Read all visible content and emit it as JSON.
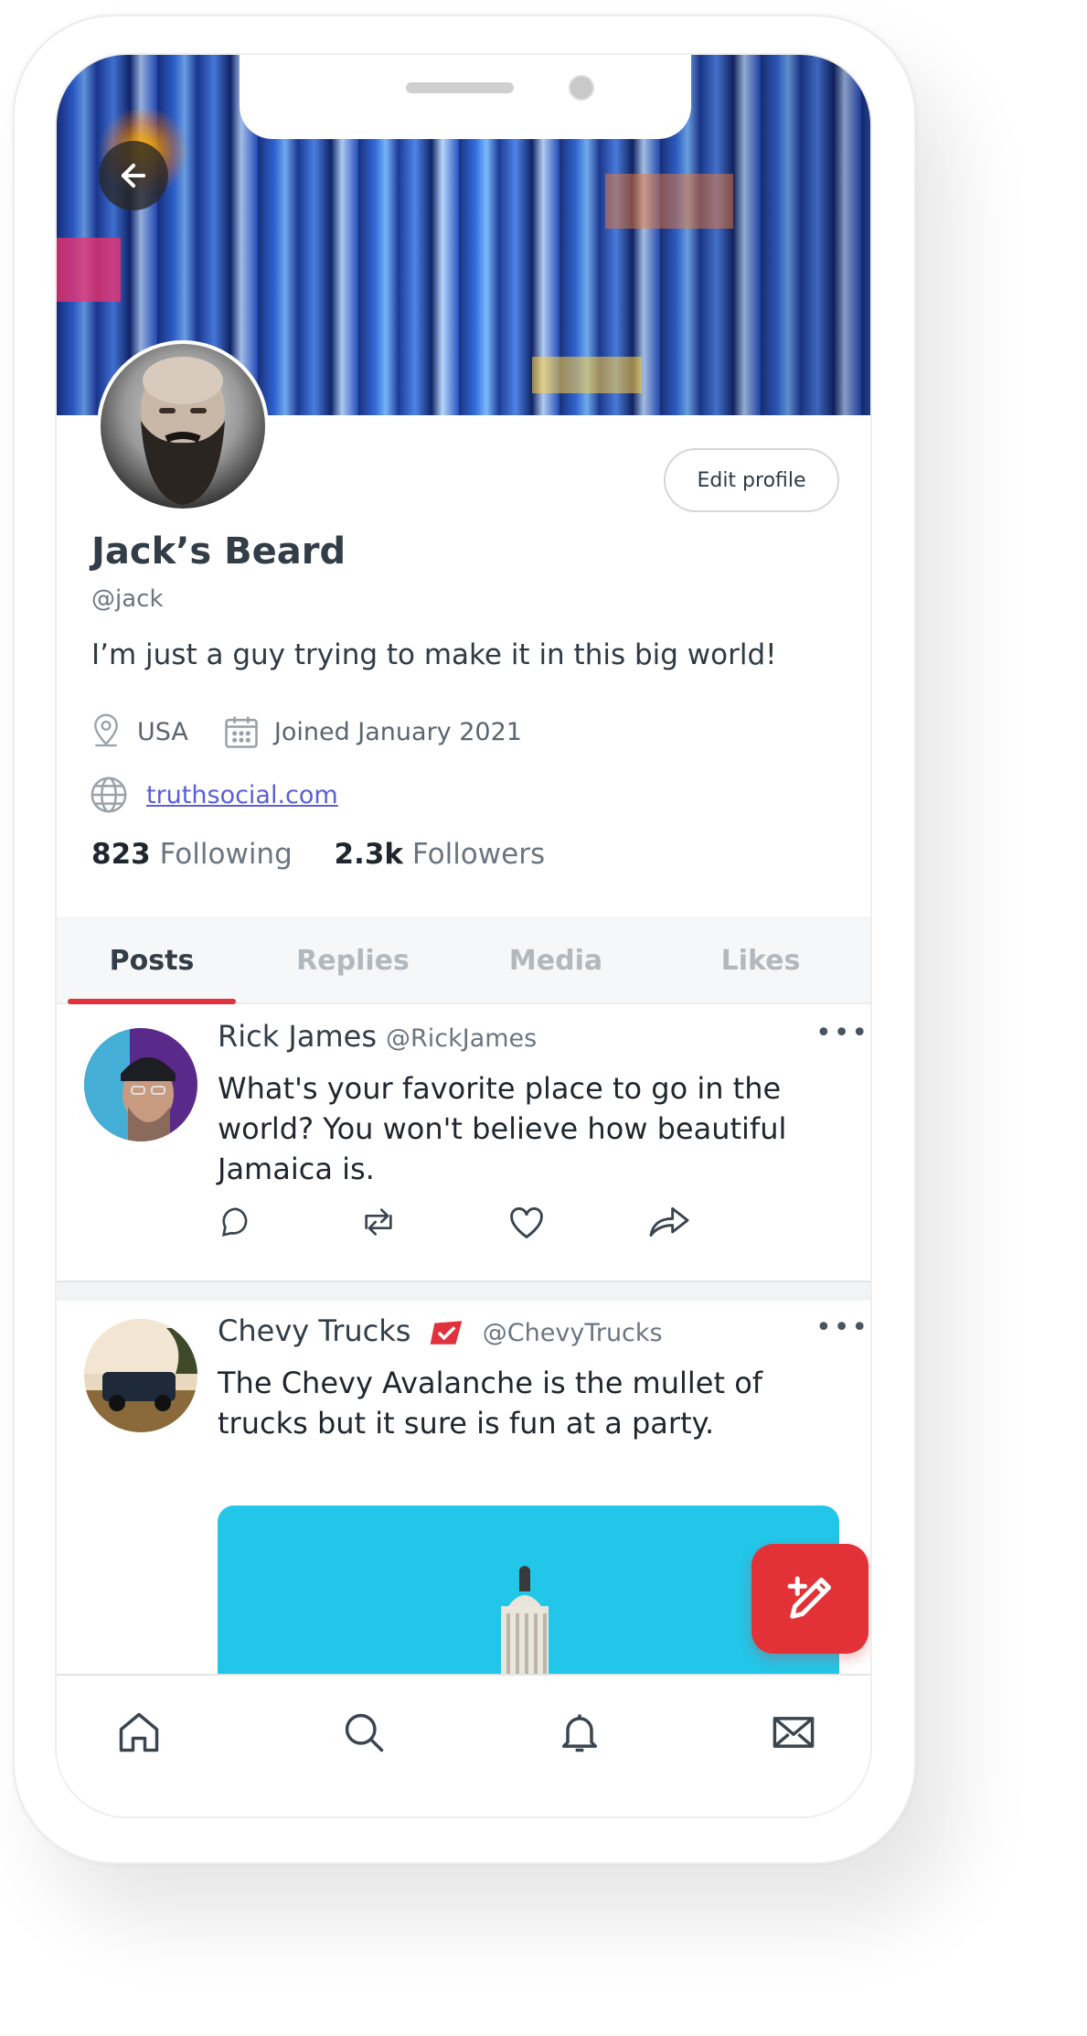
{
  "profile": {
    "name": "Jack’s Beard",
    "handle": "@jack",
    "bio": "I’m just a guy trying to make it in this big world!",
    "location": "USA",
    "joined": "Joined January 2021",
    "website": "truthsocial.com",
    "following_count": "823",
    "following_label": "Following",
    "followers_count": "2.3k",
    "followers_label": "Followers",
    "edit_label": "Edit profile"
  },
  "tabs": [
    {
      "label": "Posts",
      "active": true
    },
    {
      "label": "Replies",
      "active": false
    },
    {
      "label": "Media",
      "active": false
    },
    {
      "label": "Likes",
      "active": false
    }
  ],
  "posts": [
    {
      "name": "Rick James",
      "handle": "@RickJames",
      "text": "What's your favorite place to go in the world? You won't believe how beautiful Jamaica is.",
      "more": "•••"
    },
    {
      "name": "Chevy Trucks",
      "handle": "@ChevyTrucks",
      "verified": true,
      "text": "The Chevy Avalanche is the mullet of trucks but it sure is fun at a party.",
      "more": "•••"
    }
  ],
  "colors": {
    "accent": "#e0313c",
    "link": "#5b5fd6",
    "fab": "#e23238"
  },
  "icons": {
    "back": "arrow-left-icon",
    "location": "map-pin-icon",
    "calendar": "calendar-icon",
    "website": "globe-icon",
    "compose": "compose-icon",
    "nav": [
      "home-icon",
      "search-icon",
      "bell-icon",
      "mail-icon"
    ]
  }
}
